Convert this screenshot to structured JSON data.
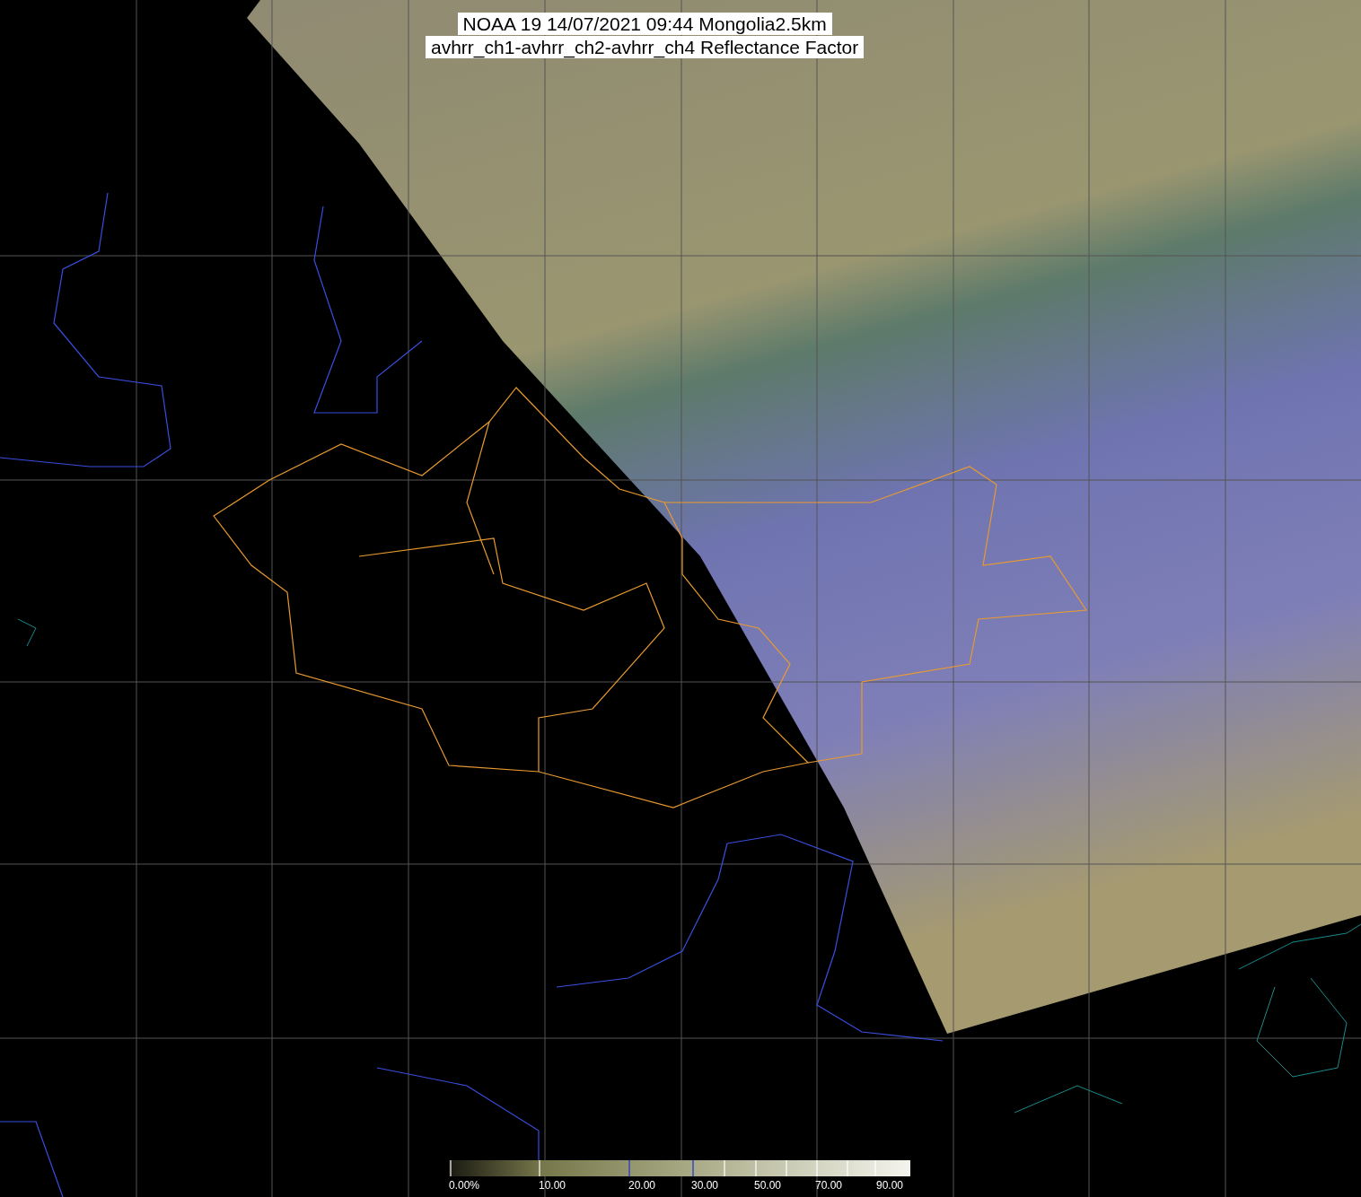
{
  "title": {
    "line_1": "NOAA 19 14/07/2021 09:44 Mongolia2.5km",
    "line_2": "avhrr_ch1-avhrr_ch2-avhrr_ch4 Reflectance Factor"
  },
  "colorbar": {
    "labels": [
      "0.00%",
      "10.00",
      "20.00",
      "30.00",
      "50.00",
      "70.00",
      "90.00"
    ]
  }
}
